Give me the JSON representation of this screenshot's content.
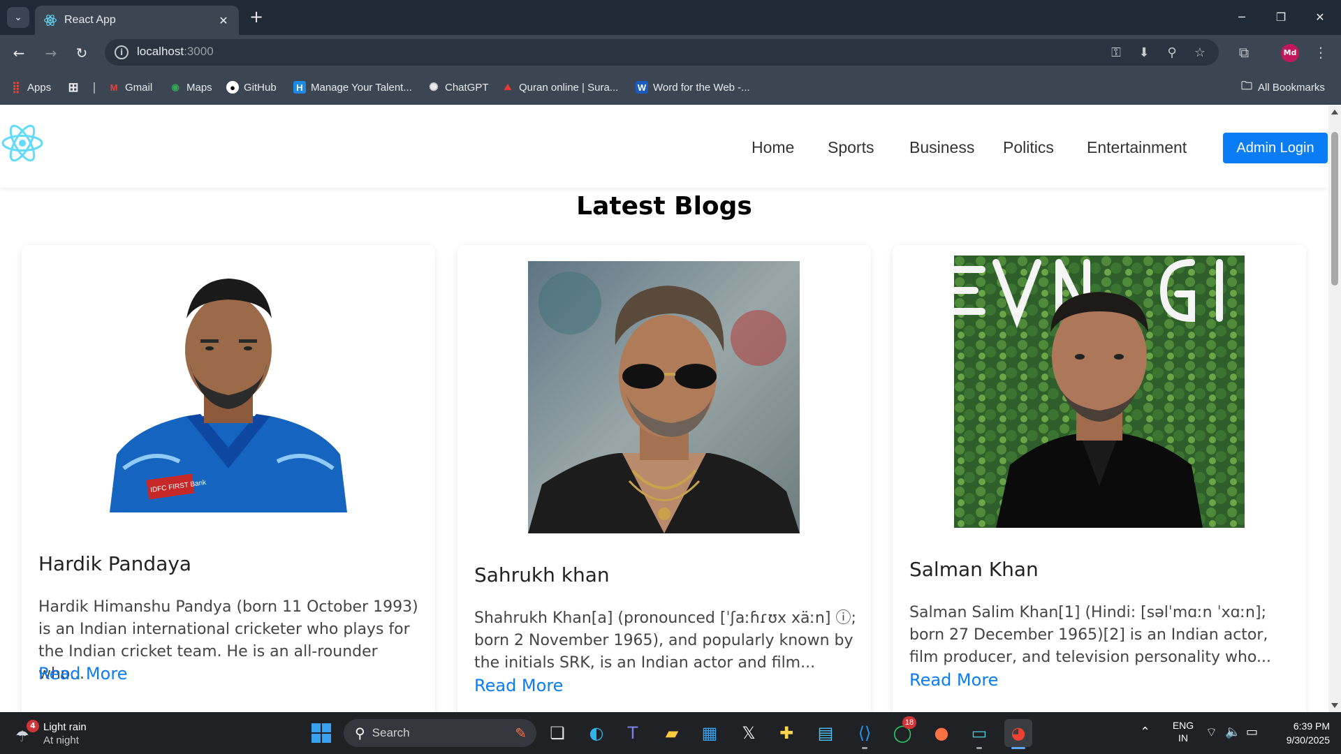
{
  "browser": {
    "tab_title": "React App",
    "url_host": "localhost",
    "url_port": ":3000",
    "profile_initials": "Md",
    "bookmarks": [
      {
        "label": "Apps"
      },
      {
        "label": "Gmail"
      },
      {
        "label": "Maps"
      },
      {
        "label": "GitHub"
      },
      {
        "label": "Manage Your Talent..."
      },
      {
        "label": "ChatGPT"
      },
      {
        "label": "Quran online | Sura..."
      },
      {
        "label": "Word for the Web -..."
      }
    ],
    "all_bookmarks": "All Bookmarks"
  },
  "navbar": {
    "links": [
      "Home",
      "Sports",
      "Business",
      "Politics",
      "Entertainment"
    ],
    "admin_button": "Admin Login"
  },
  "main": {
    "heading": "Latest Blogs",
    "cards": [
      {
        "title": "Hardik Pandaya",
        "excerpt": "Hardik Himanshu Pandya (born 11 October 1993) is an Indian international cricketer who plays for the Indian cricket team. He is an all-rounder who...",
        "read_more": "Read More",
        "jersey_text": "IDFC FIRST Bank"
      },
      {
        "title": "Sahrukh khan",
        "excerpt": "Shahrukh Khan[a] (pronounced [ˈʃaːɦɾʊx xäːn] ⓘ; born 2 November 1965), and popularly known by the initials SRK, is an Indian actor and film...",
        "read_more": "Read More"
      },
      {
        "title": "Salman Khan",
        "excerpt": "Salman Salim Khan[1] (Hindi: [səlˈmɑːn ˈxɑːn]; born 27 December 1965)[2] is an Indian actor, film producer, and television personality who...",
        "read_more": "Read More"
      }
    ]
  },
  "taskbar": {
    "weather_title": "Light rain",
    "weather_sub": "At night",
    "weather_badge": "4",
    "search_label": "Search",
    "whatsapp_badge": "18",
    "lang_1": "ENG",
    "lang_2": "IN",
    "time": "6:39 PM",
    "date": "9/30/2025"
  },
  "colors": {
    "accent": "#0a7cf5",
    "react_logo": "#61dafb",
    "chrome_dark": "#3c4653"
  }
}
